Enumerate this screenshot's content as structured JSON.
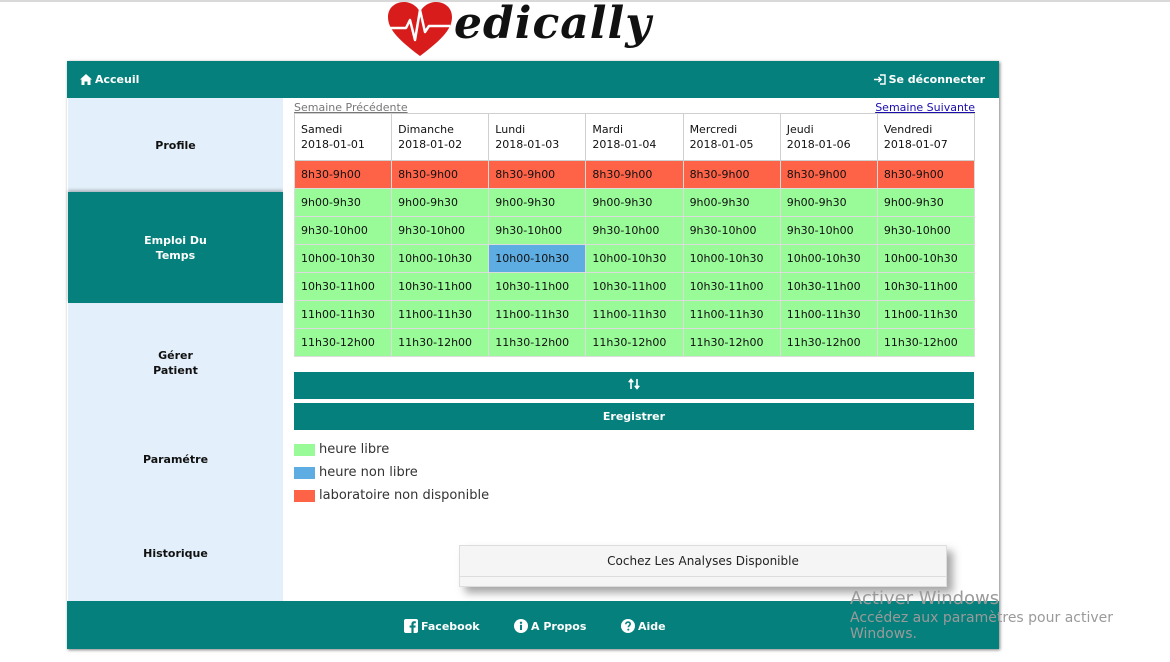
{
  "logo": {
    "word": "edically"
  },
  "topbar": {
    "home_label": "Acceuil",
    "logout_label": "Se déconnecter"
  },
  "sidebar": {
    "items": [
      {
        "label": "Profile"
      },
      {
        "label": "Emploi Du Temps",
        "active": true
      },
      {
        "label": "Gérer Patient"
      },
      {
        "label": "Paramétre"
      },
      {
        "label": "Historique"
      }
    ]
  },
  "schedule": {
    "prev_week": "Semaine Précédente",
    "next_week": "Semaine Suivante",
    "days": [
      {
        "name": "Samedi",
        "date": "2018-01-01"
      },
      {
        "name": "Dimanche",
        "date": "2018-01-02"
      },
      {
        "name": "Lundi",
        "date": "2018-01-03"
      },
      {
        "name": "Mardi",
        "date": "2018-01-04"
      },
      {
        "name": "Mercredi",
        "date": "2018-01-05"
      },
      {
        "name": "Jeudi",
        "date": "2018-01-06"
      },
      {
        "name": "Vendredi",
        "date": "2018-01-07"
      }
    ],
    "slots": [
      {
        "label": "8h30-9h00",
        "status": [
          "lab",
          "lab",
          "lab",
          "lab",
          "lab",
          "lab",
          "lab"
        ]
      },
      {
        "label": "9h00-9h30",
        "status": [
          "free",
          "free",
          "free",
          "free",
          "free",
          "free",
          "free"
        ]
      },
      {
        "label": "9h30-10h00",
        "status": [
          "free",
          "free",
          "free",
          "free",
          "free",
          "free",
          "free"
        ]
      },
      {
        "label": "10h00-10h30",
        "status": [
          "free",
          "free",
          "busy",
          "free",
          "free",
          "free",
          "free"
        ]
      },
      {
        "label": "10h30-11h00",
        "status": [
          "free",
          "free",
          "free",
          "free",
          "free",
          "free",
          "free"
        ]
      },
      {
        "label": "11h00-11h30",
        "status": [
          "free",
          "free",
          "free",
          "free",
          "free",
          "free",
          "free"
        ]
      },
      {
        "label": "11h30-12h00",
        "status": [
          "free",
          "free",
          "free",
          "free",
          "free",
          "free",
          "free"
        ]
      }
    ],
    "colors": {
      "free": "#98fb98",
      "busy": "#5dade2",
      "lab": "#ff6347"
    }
  },
  "buttons": {
    "swap_icon": "sort-arrows-icon",
    "save_label": "Eregistrer"
  },
  "legend": [
    {
      "label": "heure libre",
      "status": "free"
    },
    {
      "label": "heure non libre",
      "status": "busy"
    },
    {
      "label": "laboratoire non disponible",
      "status": "lab"
    }
  ],
  "panel": {
    "title": "Cochez Les Analyses Disponible"
  },
  "footer": {
    "facebook": "Facebook",
    "about": "A Propos",
    "help": "Aide"
  },
  "watermark": {
    "line1": "Activer Windows",
    "line2": "Accédez aux paramètres pour activer Windows."
  }
}
